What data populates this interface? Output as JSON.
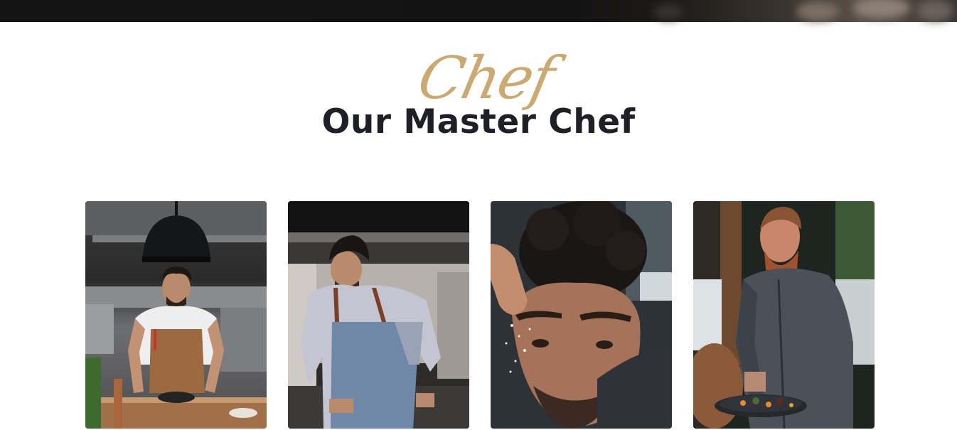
{
  "section": {
    "script_title": "Chef",
    "title": "Our Master Chef"
  },
  "chefs": [
    {
      "photo": "chef-photo-kitchen-plating"
    },
    {
      "photo": "chef-photo-cooking-apron"
    },
    {
      "photo": "chef-photo-seasoning-closeup"
    },
    {
      "photo": "chef-photo-holding-plate"
    }
  ],
  "colors": {
    "accent_gold": "#c9a56b",
    "title_dark": "#1f2027",
    "top_strip": "#141313"
  }
}
